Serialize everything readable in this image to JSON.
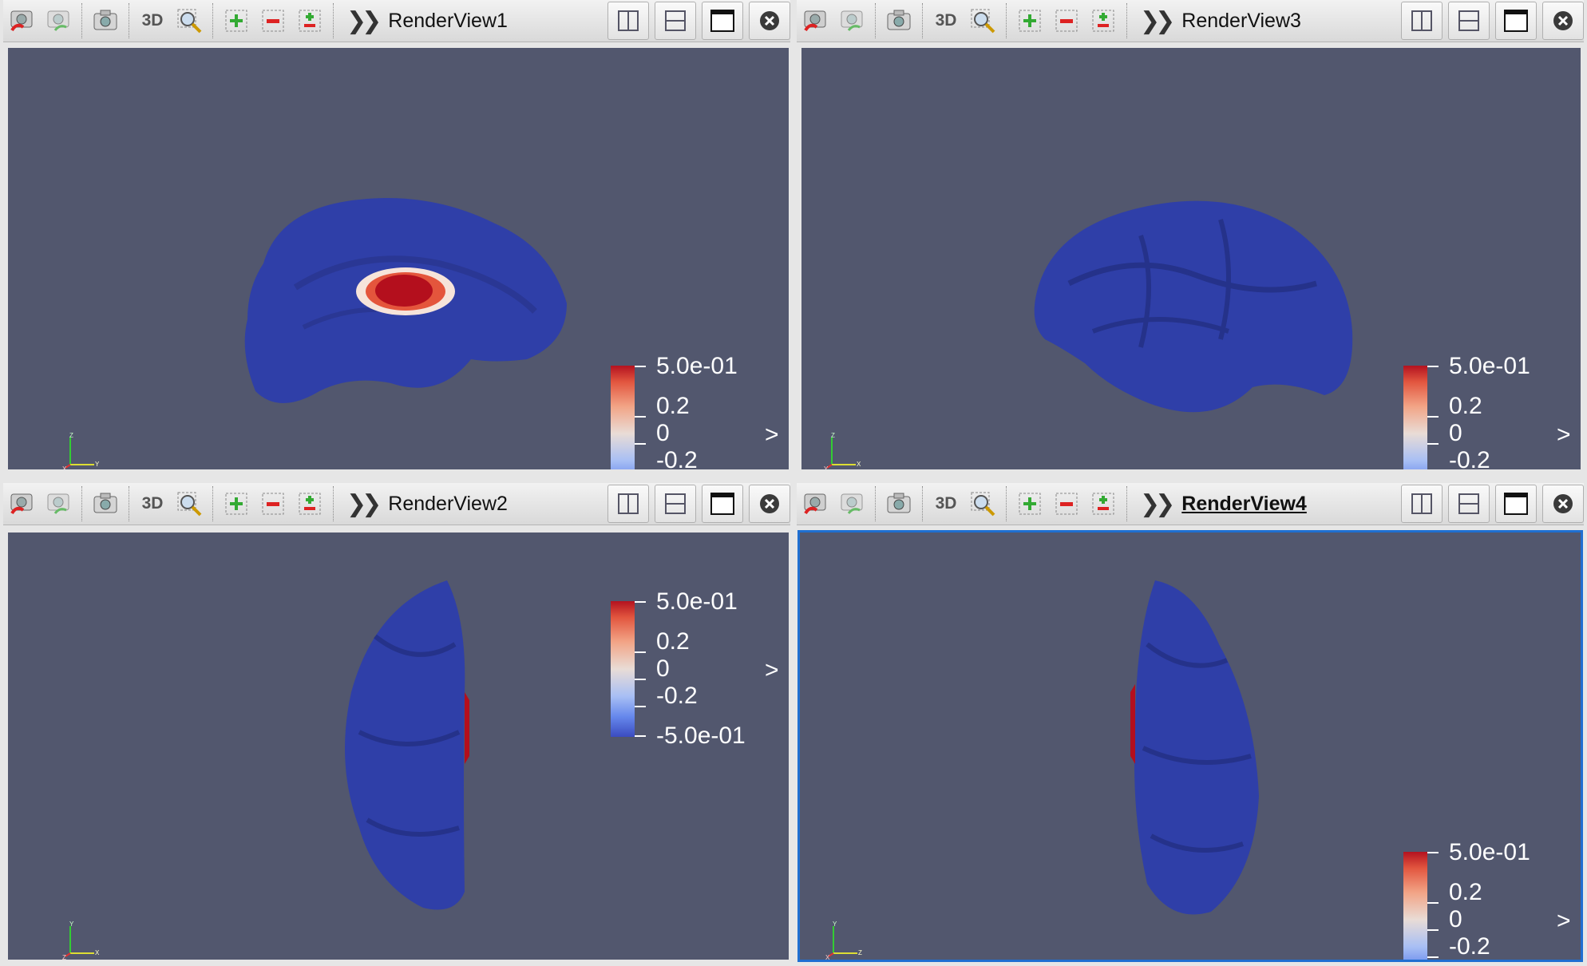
{
  "toolbar": {
    "three_d_label": "3D",
    "icons": [
      "reset-camera-icon",
      "reset-camera-closest-icon",
      "screenshot-icon",
      "3d-toggle",
      "zoom-to-box-icon",
      "select-plus-icon",
      "select-minus-icon",
      "select-toggle-icon"
    ]
  },
  "views": [
    {
      "id": "rv1",
      "title": "RenderView1",
      "active": false,
      "axes_labels": [
        "Z",
        "X",
        "Y"
      ]
    },
    {
      "id": "rv3",
      "title": "RenderView3",
      "active": false,
      "axes_labels": [
        "Z",
        "Y",
        "X"
      ]
    },
    {
      "id": "rv2",
      "title": "RenderView2",
      "active": false,
      "axes_labels": [
        "Y",
        "Z",
        "X"
      ]
    },
    {
      "id": "rv4",
      "title": "RenderView4",
      "active": true,
      "axes_labels": [
        "Y",
        "X",
        "Z"
      ]
    }
  ],
  "legend": {
    "labels": [
      "5.0e-01",
      "0.2",
      "0",
      "-0.2",
      "-5.0e-01"
    ],
    "colors": {
      "max": "#b4121f",
      "mid": "#e9dcd6",
      "min": "#3b4cc0"
    }
  },
  "expander_glyph": ">",
  "colors": {
    "viewport_bg": "#52576e",
    "surface_blue": "#2f3fa8",
    "active_border": "#1f6fd1",
    "activation_red": "#b40f1d"
  }
}
